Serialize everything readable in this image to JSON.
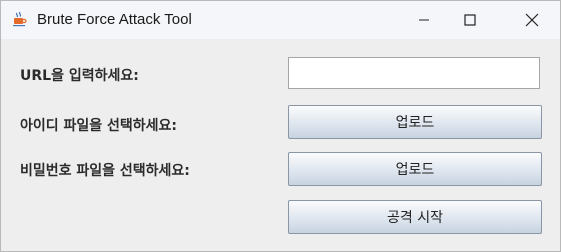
{
  "window": {
    "title": "Brute Force Attack Tool",
    "app_icon": "java-icon"
  },
  "controls": {
    "minimize_icon": "minimize-icon",
    "maximize_icon": "maximize-icon",
    "close_icon": "close-icon"
  },
  "form": {
    "url_label": "URL을 입력하세요:",
    "url_value": "",
    "id_file_label": "아이디 파일을 선택하세요:",
    "id_upload_label": "업로드",
    "pw_file_label": "비밀번호 파일을 선택하세요:",
    "pw_upload_label": "업로드",
    "start_label": "공격 시작"
  }
}
